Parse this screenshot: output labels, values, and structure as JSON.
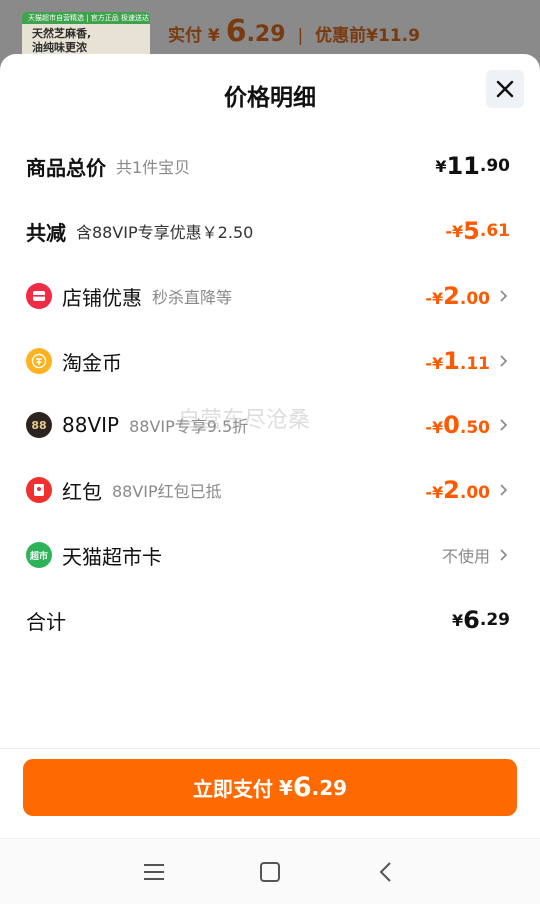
{
  "background": {
    "thumb_banner": "天猫超市自营精选 | 官方正品 极速送达",
    "thumb_line1": "天然芝麻香,",
    "thumb_line2": "油纯味更浓",
    "pay_label": "实付",
    "pay_symbol": "¥",
    "pay_int": "6",
    "pay_dec": ".29",
    "before_label": "优惠前",
    "before_amount": "¥11.9"
  },
  "sheet": {
    "title": "价格明细",
    "close_icon": "close-icon"
  },
  "rows": {
    "total": {
      "label": "商品总价",
      "sub": "共1件宝贝",
      "sym": "¥",
      "int": "11",
      "dec": ".90"
    },
    "reduce": {
      "label": "共减",
      "sub": "含88VIP专享优惠￥2.50",
      "sym": "-¥",
      "int": "5",
      "dec": ".61"
    },
    "shop": {
      "label": "店铺优惠",
      "sub": "秒杀直降等",
      "sym": "-¥",
      "int": "2",
      "dec": ".00",
      "icon": "shop-icon"
    },
    "coin": {
      "label": "淘金币",
      "sym": "-¥",
      "int": "1",
      "dec": ".11",
      "icon": "coin-icon"
    },
    "vip": {
      "label": "88VIP",
      "sub": "88VIP专享9.5折",
      "sym": "-¥",
      "int": "0",
      "dec": ".50",
      "icon": "vip-icon",
      "icon_text": "88"
    },
    "redpack": {
      "label": "红包",
      "sub": "88VIP红包已抵",
      "sym": "-¥",
      "int": "2",
      "dec": ".00",
      "icon": "redpack-icon"
    },
    "card": {
      "label": "天猫超市卡",
      "right": "不使用",
      "icon": "market-card-icon",
      "icon_text": "超市"
    },
    "sum": {
      "label": "合计",
      "sym": "¥",
      "int": "6",
      "dec": ".29"
    }
  },
  "watermark": "自营东尽沧桑",
  "pay_button": {
    "label": "立即支付",
    "sym": "¥",
    "int": "6",
    "dec": ".29"
  },
  "navbar": {
    "menu": "menu-icon",
    "home": "home-icon",
    "back": "back-icon"
  },
  "colors": {
    "accent": "#ff6a00",
    "discount": "#ff5a00"
  }
}
